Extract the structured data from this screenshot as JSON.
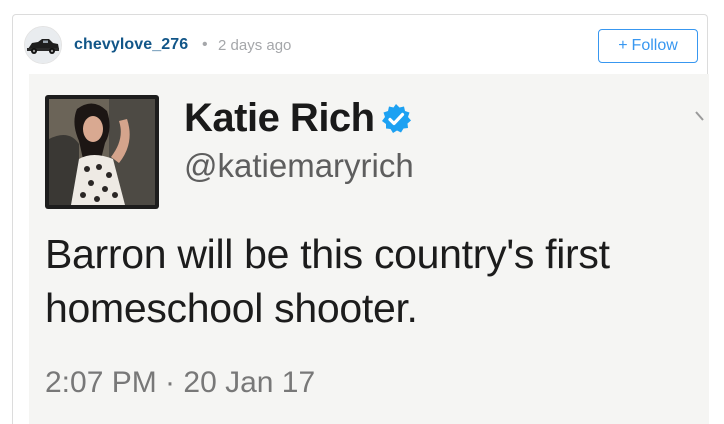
{
  "post": {
    "username": "chevylove_276",
    "separator": "•",
    "time_ago": "2 days ago",
    "follow_plus": "+",
    "follow_label": "Follow",
    "avatar_icon": "classic-car-icon"
  },
  "tweet": {
    "name": "Katie Rich",
    "verified_icon": "verified-badge-icon",
    "handle": "@katiemaryrich",
    "text": "Barron will be this country's first homeschool shooter.",
    "timestamp": "2:07 PM · 20 Jan 17",
    "menu_icon": "chevron-down-icon"
  },
  "colors": {
    "username": "#125688",
    "follow_accent": "#3897f0",
    "verified": "#1da1f2",
    "muted": "#a5a7aa"
  }
}
